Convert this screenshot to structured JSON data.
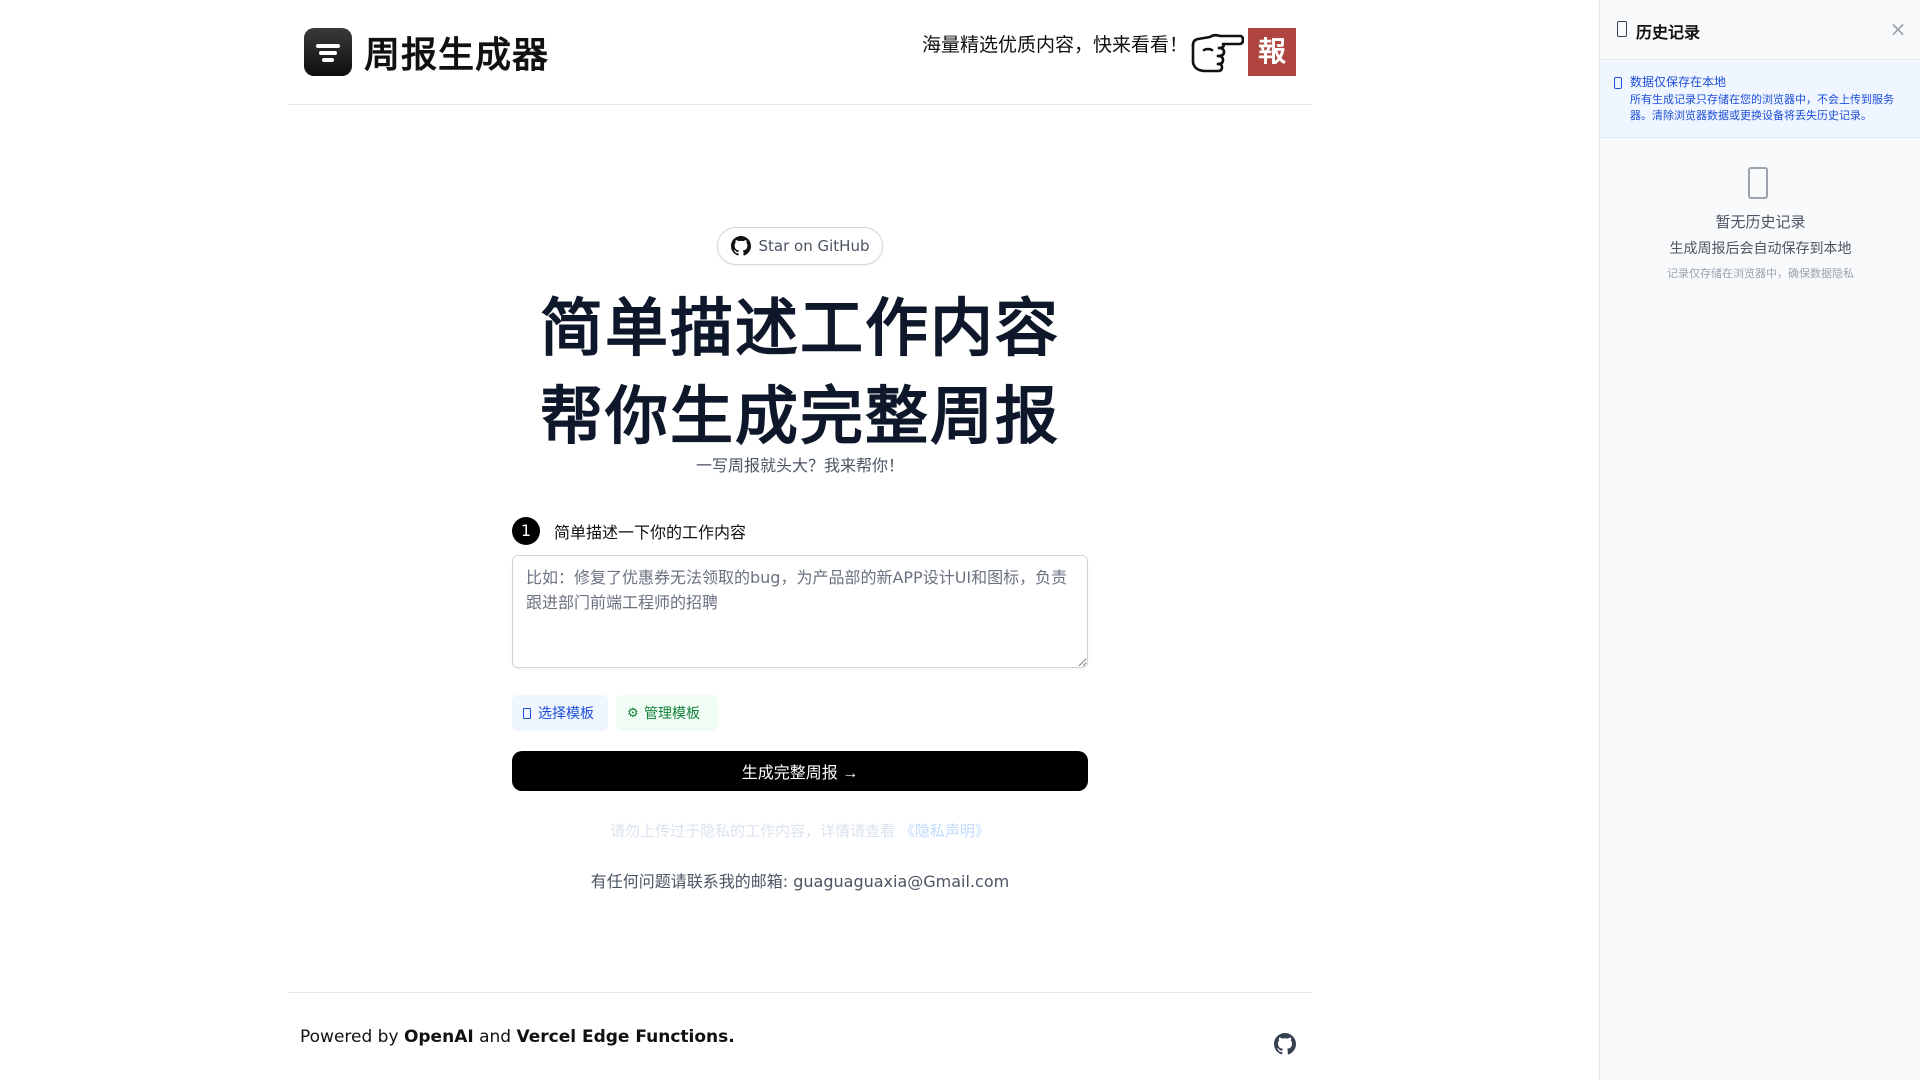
{
  "header": {
    "brand": "周报生成器",
    "promo": "海量精选优质内容，快来看看！",
    "promo_badge": "報",
    "hand_icon": "pointing-hand-icon"
  },
  "hero": {
    "star_button": "Star on GitHub",
    "headline_line1": "简单描述工作内容",
    "headline_line2": "帮你生成完整周报",
    "subtitle": "一写周报就头大？我来帮你！"
  },
  "form": {
    "step_number": "1",
    "step_label": "简单描述一下你的工作内容",
    "textarea_placeholder": "比如：修复了优惠券无法领取的bug，为产品部的新APP设计UI和图标，负责跟进部门前端工程师的招聘",
    "select_template": "选择模板",
    "manage_template": "管理模板",
    "manage_icon": "⚙",
    "generate_button": "生成完整周报 →"
  },
  "notes": {
    "privacy_text": "请勿上传过于隐私的工作内容，详情请查看",
    "privacy_link": "《隐私声明》",
    "contact": "有任何问题请联系我的邮箱: guaguaguaxia@Gmail.com"
  },
  "footer": {
    "powered_prefix": "Powered by ",
    "openai": "OpenAI",
    "and": " and ",
    "vercel": "Vercel Edge Functions."
  },
  "sidebar": {
    "title": "历史记录",
    "close": "×",
    "notice_title": "数据仅保存在本地",
    "notice_body": "所有生成记录只存储在您的浏览器中，不会上传到服务器。清除浏览器数据或更换设备将丢失历史记录。",
    "empty_title": "暂无历史记录",
    "empty_sub": "生成周报后会自动保存到本地",
    "empty_note": "记录仅存储在浏览器中，确保数据隐私"
  },
  "colors": {
    "badge_red": "#b0453f",
    "primary_button": "#000000",
    "select_template_bg": "#eff6ff",
    "manage_template_bg": "#f0fdf4",
    "sidebar_notice_bg": "#eff6ff"
  }
}
